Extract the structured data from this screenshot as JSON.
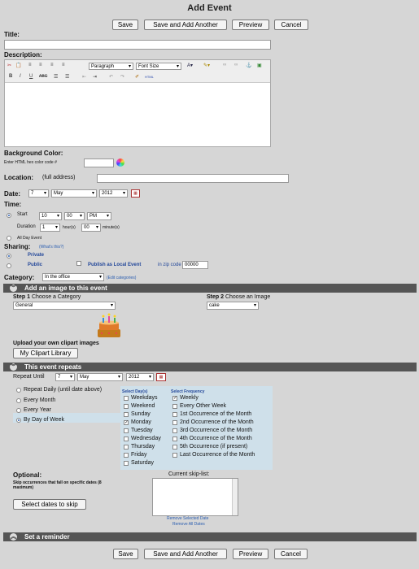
{
  "page": {
    "title": "Add Event"
  },
  "buttons": {
    "save": "Save",
    "save_add": "Save and Add Another",
    "preview": "Preview",
    "cancel": "Cancel"
  },
  "title_field": {
    "label": "Title:",
    "value": ""
  },
  "description": {
    "label": "Description:",
    "format": "Paragraph",
    "font_size": "Font Size"
  },
  "bg": {
    "label": "Background Color:",
    "hint": "Enter HTML hex color code #",
    "value": ""
  },
  "location": {
    "label": "Location:",
    "hint": "(full address)",
    "value": ""
  },
  "date": {
    "label": "Date:",
    "day": "7",
    "month": "May",
    "year": "2012"
  },
  "time": {
    "label": "Time:",
    "start": "Start",
    "hour": "10",
    "minute": "00",
    "ampm": "PM",
    "duration": "Duration",
    "dur_hours": "1",
    "hours_unit": "hour(s)",
    "dur_minutes": "00",
    "minutes_unit": "minute(s)",
    "all_day": "All Day Event"
  },
  "sharing": {
    "label": "Sharing:",
    "whats": "(What's this?)",
    "private": "Private",
    "public": "Public",
    "publish": "Publish as Local Event",
    "zip_label": "in zip code",
    "zip": "00000"
  },
  "category": {
    "label": "Category:",
    "value": "In the office",
    "edit": "Edit categories"
  },
  "image": {
    "section": "Add an image to this event",
    "step1_b": "Step 1",
    "step1": "Choose a Category",
    "cat_value": "General",
    "step2_b": "Step 2",
    "step2": "Choose an Image",
    "img_value": "cake",
    "upload": "Upload your own clipart images",
    "library": "My Clipart Library"
  },
  "repeat": {
    "section": "This event repeats",
    "until": "Repeat Until",
    "day": "7",
    "month": "May",
    "year": "2012",
    "modes": [
      "Repeat Daily (until date above)",
      "Every Month",
      "Every Year",
      "By Day of Week"
    ],
    "days_header": "Select Day(s)",
    "days": [
      "Weekdays",
      "Weekend",
      "Sunday",
      "Monday",
      "Tuesday",
      "Wednesday",
      "Thursday",
      "Friday",
      "Saturday"
    ],
    "freq_header": "Select Frequency",
    "freq": [
      "Weekly",
      "Every Other Week",
      "1st Occurrence of the Month",
      "2nd Occurrence of the Month",
      "3rd Occurrence of the Month",
      "4th Occurrence of the Month",
      "5th Occurrence (if present)",
      "Last Occurrence of the Month"
    ]
  },
  "optional": {
    "label": "Optional:",
    "desc": "Skip occurrences that fall on specific dates (8 maximum)",
    "button": "Select dates to skip",
    "skip_title": "Current skip-list:",
    "remove_sel": "Remove Selected Date",
    "remove_all": "Remove All Dates"
  },
  "reminder": {
    "section": "Set a reminder"
  },
  "colors": {
    "section_bg": "#555555",
    "page_bg": "#d6d6d6",
    "panel_bg": "#cfe0ea",
    "link": "#2a5db0"
  }
}
